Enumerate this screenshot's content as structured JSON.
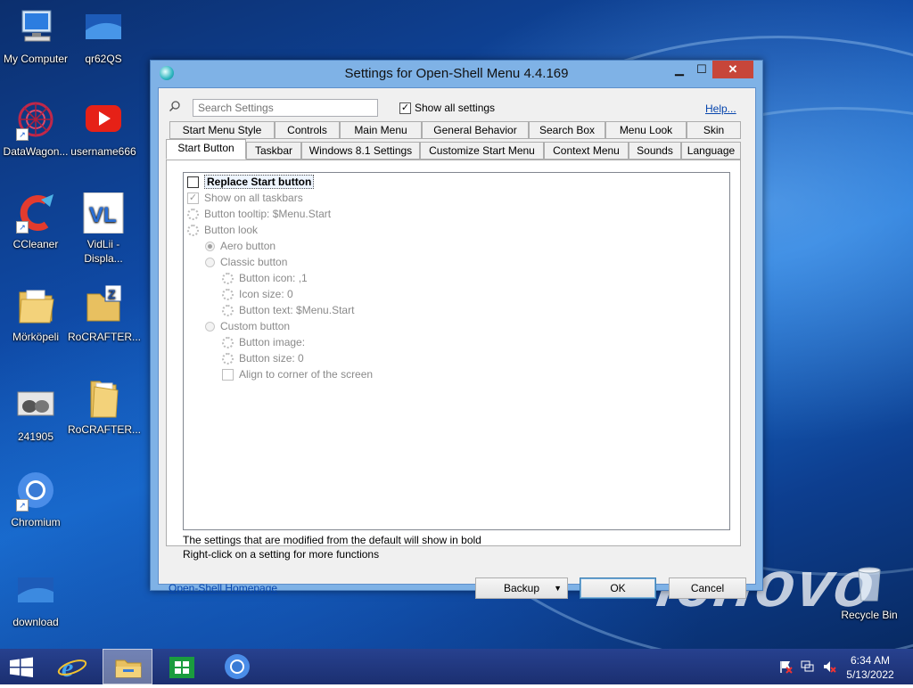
{
  "desktop": {
    "icons": [
      {
        "label": "My Computer"
      },
      {
        "label": "qr62QS"
      },
      {
        "label": "DataWagon..."
      },
      {
        "label": "username666"
      },
      {
        "label": "CCleaner"
      },
      {
        "label": "VidLii - Displa..."
      },
      {
        "label": "Mörköpeli"
      },
      {
        "label": "RoCRAFTER..."
      },
      {
        "label": "241905"
      },
      {
        "label": "RoCRAFTER..."
      },
      {
        "label": "Chromium"
      },
      {
        "label": "download"
      },
      {
        "label": "Recycle Bin"
      }
    ],
    "wallpaper_brand": "lenovo"
  },
  "dialog": {
    "title": "Settings for Open-Shell Menu 4.4.169",
    "search_placeholder": "Search Settings",
    "show_all_label": "Show all settings",
    "help_link": "Help...",
    "tabs_row1": [
      "Start Menu Style",
      "Controls",
      "Main Menu",
      "General Behavior",
      "Search Box",
      "Menu Look",
      "Skin"
    ],
    "tabs_row2": [
      "Start Button",
      "Taskbar",
      "Windows 8.1 Settings",
      "Customize Start Menu",
      "Context Menu",
      "Sounds",
      "Language"
    ],
    "settings": [
      "Replace Start button",
      "Show on all taskbars",
      "Button tooltip: $Menu.Start",
      "Button look",
      "Aero button",
      "Classic button",
      "Button icon: ,1",
      "Icon size: 0",
      "Button text: $Menu.Start",
      "Custom button",
      "Button image:",
      "Button size: 0",
      "Align to corner of the screen"
    ],
    "note1": "The settings that are modified from the default will show in bold",
    "note2": "Right-click on a setting for more functions",
    "homepage_link": "Open-Shell Homepage",
    "backup_label": "Backup",
    "ok_label": "OK",
    "cancel_label": "Cancel"
  },
  "taskbar": {
    "time": "6:34 AM",
    "date": "5/13/2022"
  }
}
